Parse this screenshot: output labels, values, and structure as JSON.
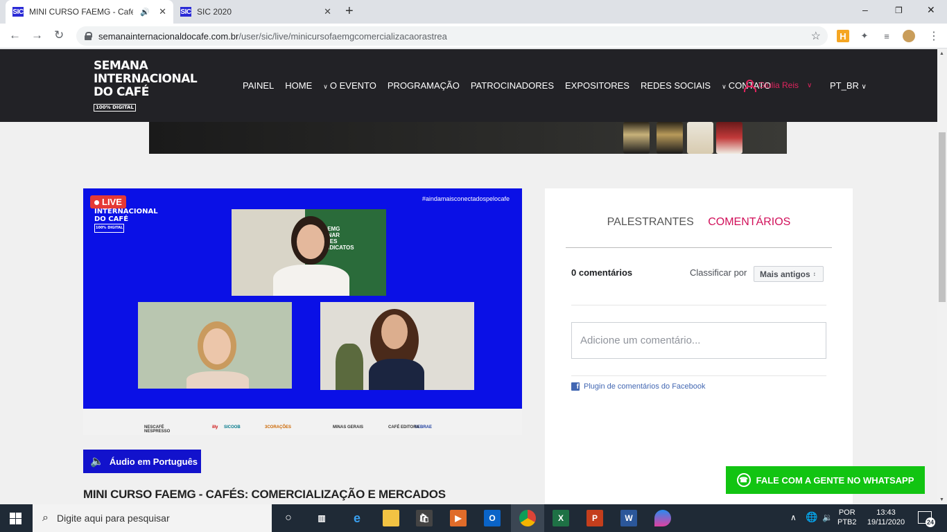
{
  "browser": {
    "tabs": [
      {
        "favicon": "SIC",
        "title": "MINI CURSO FAEMG - Cafés",
        "audio": true,
        "active": true
      },
      {
        "favicon": "SIC",
        "title": "SIC 2020",
        "audio": false,
        "active": false
      }
    ],
    "new_tab": "+",
    "url_host": "semanainternacionaldocafe.com.br",
    "url_path": "/user/sic/live/minicursofaemgcomercializacaorastrea"
  },
  "site": {
    "logo_lines": [
      "SEMANA",
      "INTERNACIONAL",
      "DO CAFÉ"
    ],
    "logo_badge": "100% DIGITAL",
    "nav": [
      {
        "label": "PAINEL",
        "caret": false
      },
      {
        "label": "HOME",
        "caret": false
      },
      {
        "label": "O EVENTO",
        "caret": true
      },
      {
        "label": "PROGRAMAÇÃO",
        "caret": false
      },
      {
        "label": "PATROCINADORES",
        "caret": false
      },
      {
        "label": "EXPOSITORES",
        "caret": false
      },
      {
        "label": "REDES SOCIAIS",
        "caret": false
      },
      {
        "label": "CONTATO",
        "caret": true
      }
    ],
    "user_name": "Giulia Reis",
    "language": "PT_BR"
  },
  "video": {
    "live_badge": "LIVE",
    "hashtag": "#aindamaisconectadospelocafe",
    "overlay_logo": [
      "INTERNACIONAL",
      "DO CAFÉ"
    ],
    "overlay_badge": "100% DIGITAL",
    "backdrop_text": [
      "FAEMG",
      "SENAR",
      "INAES",
      "SINDICATOS"
    ],
    "sponsors": [
      "NESCAFÉ",
      "NESPRESSO",
      "illy",
      "SICOOB",
      "3CORAÇÕES",
      "MINAS GERAIS",
      "SEBRAE",
      "CAFÉ EDITORA"
    ]
  },
  "audio_button": "Áudio em Português",
  "page_title": "MINI CURSO FAEMG - CAFÉS: COMERCIALIZAÇÃO E MERCADOS",
  "comments": {
    "tab_speakers": "PALESTRANTES",
    "tab_comments": "COMENTÁRIOS",
    "count": "0 comentários",
    "sort_label": "Classificar por",
    "sort_value": "Mais antigos",
    "placeholder": "Adicione um comentário...",
    "plugin_text": "Plugin de comentários do Facebook"
  },
  "whatsapp_button": "FALE COM A GENTE NO WHATSAPP",
  "taskbar": {
    "search_placeholder": "Digite aqui para pesquisar",
    "lang_top": "POR",
    "lang_bottom": "PTB2",
    "time": "13:43",
    "date": "19/11/2020",
    "notification_count": "24"
  },
  "colors": {
    "header_bg": "#222226",
    "accent_pink": "#d1105a",
    "video_blue": "#0a10e6",
    "audio_blue": "#1212cc",
    "whatsapp_green": "#12c412"
  }
}
